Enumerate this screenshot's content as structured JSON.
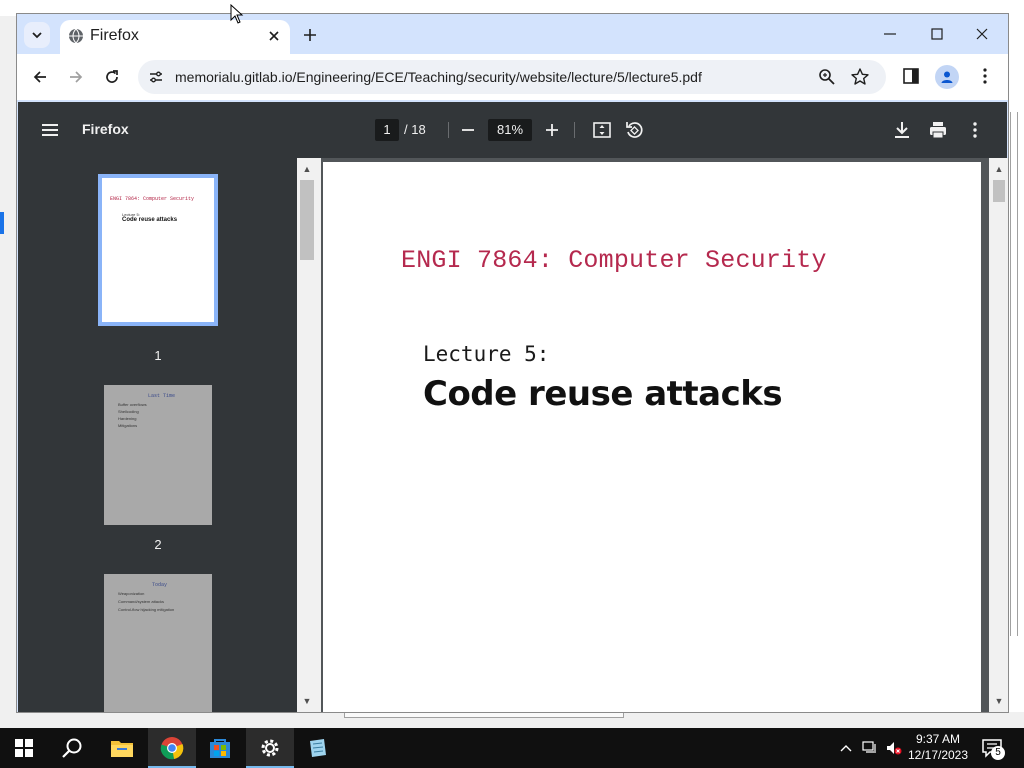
{
  "browser": {
    "tab": {
      "title": "Firefox"
    },
    "omnibox": {
      "url": "memorialu.gitlab.io/Engineering/ECE/Teaching/security/website/lecture/5/lecture5.pdf"
    }
  },
  "pdf_viewer": {
    "title": "Firefox",
    "current_page": "1",
    "total_pages": "/ 18",
    "zoom": "81%",
    "thumbnails": [
      {
        "label": "1",
        "heading": "ENGI 7864: Computer Security",
        "lecture": "Lecture 5:",
        "title": "Code reuse attacks"
      },
      {
        "label": "2",
        "heading": "Last Time",
        "lines": [
          "Buffer overflows",
          "Shellcoding",
          "Hardening",
          "Mitigations"
        ]
      },
      {
        "label": "",
        "heading": "Today",
        "lines": [
          "Weaponization",
          "Command/system attacks",
          "Control-flow hijacking mitigation"
        ]
      }
    ]
  },
  "document": {
    "heading": "ENGI 7864: Computer Security",
    "lecture": "Lecture 5:",
    "title": "Code reuse attacks"
  },
  "taskbar": {
    "time": "9:37 AM",
    "date": "12/17/2023",
    "notification_count": "5"
  },
  "colors": {
    "chrome_frame": "#d3e3fd",
    "pdf_toolbar": "#323639",
    "pdf_heading_red": "#b5294e",
    "thumb_selected": "#8ab4f8"
  }
}
